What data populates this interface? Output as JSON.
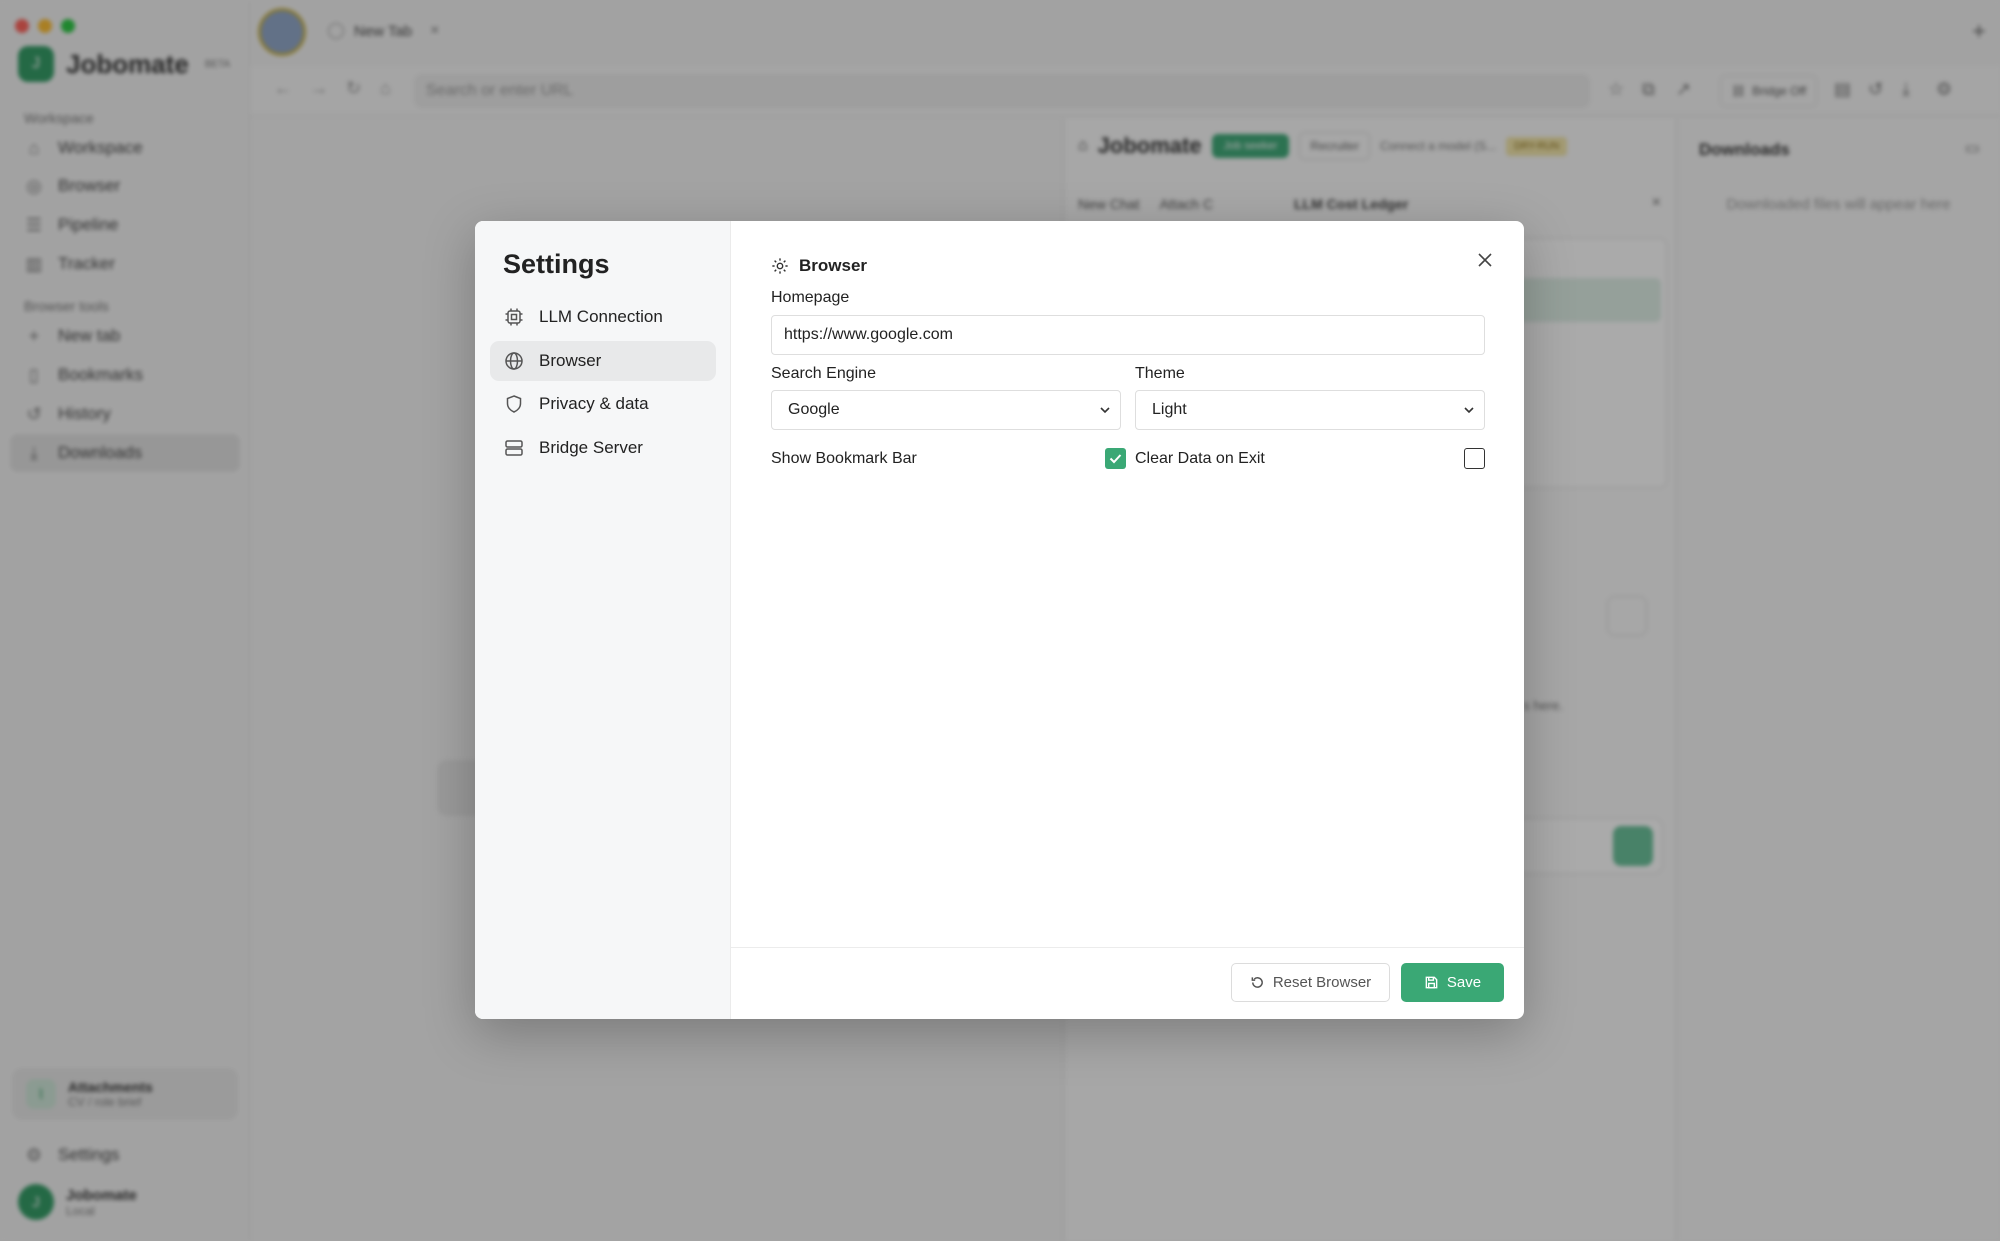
{
  "app": {
    "name": "Jobomate",
    "beta": "BETA"
  },
  "sidebar": {
    "section_workspace": "Workspace",
    "workspace_items": [
      {
        "label": "Workspace",
        "icon": "home-icon"
      },
      {
        "label": "Browser",
        "icon": "globe-icon"
      },
      {
        "label": "Pipeline",
        "icon": "pipeline-icon"
      },
      {
        "label": "Tracker",
        "icon": "chart-icon"
      }
    ],
    "section_tools": "Browser tools",
    "tool_items": [
      {
        "label": "New tab",
        "icon": "plus-icon"
      },
      {
        "label": "Bookmarks",
        "icon": "book-icon"
      },
      {
        "label": "History",
        "icon": "history-icon"
      },
      {
        "label": "Downloads",
        "icon": "download-icon"
      }
    ],
    "attachments": {
      "title": "Attachments",
      "subtitle": "CV / role brief"
    },
    "settings_label": "Settings",
    "user": {
      "name": "Jobomate",
      "subtitle": "Local"
    }
  },
  "tabbar": {
    "tab_title": "New Tab"
  },
  "addressbar": {
    "url_placeholder": "Search or enter URL",
    "bridge_label": "Bridge Off"
  },
  "jobomate_panel": {
    "title": "Jobomate",
    "job_seeker": "Job seeker",
    "recruiter": "Recruiter",
    "connect_note": "Connect a model (S...",
    "badge": "DRY-RUN",
    "new_chat": "New Chat",
    "attach": "Attach C",
    "ledger_title": "LLM Cost Ledger",
    "hint": "s here."
  },
  "downloads_panel": {
    "title": "Downloads",
    "empty": "Downloaded files will appear here"
  },
  "settings_modal": {
    "title": "Settings",
    "menu": [
      {
        "label": "LLM Connection",
        "icon": "chip-icon"
      },
      {
        "label": "Browser",
        "icon": "globe-icon",
        "active": true
      },
      {
        "label": "Privacy & data",
        "icon": "shield-icon"
      },
      {
        "label": "Bridge Server",
        "icon": "server-icon"
      }
    ],
    "section_title": "Browser",
    "homepage_label": "Homepage",
    "homepage_value": "https://www.google.com",
    "search_engine_label": "Search Engine",
    "search_engine_value": "Google",
    "theme_label": "Theme",
    "theme_value": "Light",
    "bookmark_bar_label": "Show Bookmark Bar",
    "bookmark_bar_checked": true,
    "clear_data_label": "Clear Data on Exit",
    "clear_data_checked": false,
    "reset_label": "Reset Browser",
    "save_label": "Save"
  },
  "colors": {
    "accent": "#3aa875",
    "overlay": "rgba(20,20,20,0.36)"
  }
}
